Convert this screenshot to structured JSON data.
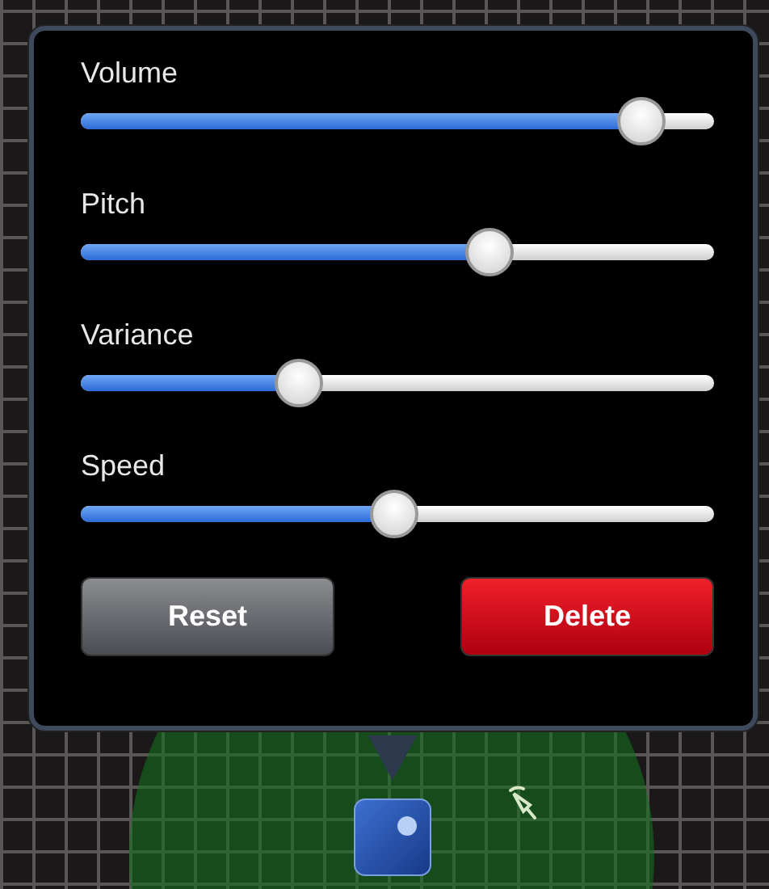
{
  "sliders": [
    {
      "label": "Volume",
      "level": 0.89
    },
    {
      "label": "Pitch",
      "level": 0.65
    },
    {
      "label": "Variance",
      "level": 0.35
    },
    {
      "label": "Speed",
      "level": 0.5
    }
  ],
  "buttons": [
    {
      "label": "Reset",
      "kind": "neutral"
    },
    {
      "label": "Delete",
      "kind": "destructive"
    }
  ]
}
